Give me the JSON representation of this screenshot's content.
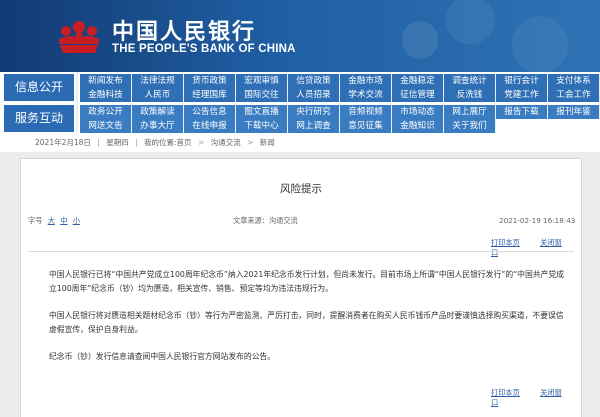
{
  "header": {
    "brand_cn": "中国人民银行",
    "brand_en": "THE PEOPLE'S BANK OF CHINA"
  },
  "nav": {
    "groups": [
      {
        "label": "信息公开",
        "rows": [
          [
            "新闻发布",
            "法律法规",
            "货币政策",
            "宏观审慎",
            "信贷政策",
            "金融市场",
            "金融稳定",
            "调查统计",
            "银行会计",
            "支付体系"
          ],
          [
            "金融科技",
            "人民币",
            "经理国库",
            "国际交往",
            "人员招录",
            "学术交流",
            "征信管理",
            "反洗钱",
            "党建工作",
            "工会工作"
          ]
        ]
      },
      {
        "label": "服务互动",
        "rows": [
          [
            "政务公开",
            "政策解读",
            "公告信息",
            "图文直播",
            "央行研究",
            "音频视频",
            "市场动态",
            "网上展厅",
            "报告下载",
            "报刊年鉴"
          ],
          [
            "网送文告",
            "办事大厅",
            "在线申报",
            "下载中心",
            "网上调查",
            "意见征集",
            "金融知识",
            "关于我们"
          ]
        ]
      }
    ]
  },
  "breadcrumb": {
    "date": "2021年2月18日",
    "weekday": "星期四",
    "location_label": "我的位置:首页",
    "section": "沟通交流",
    "current": "新闻"
  },
  "article": {
    "title": "风险提示",
    "font_label": "字号",
    "font_large": "大",
    "font_medium": "中",
    "font_small": "小",
    "source": "文章来源：沟通交流",
    "datetime": "2021-02-19 16:18:43",
    "print_label": "打印本页",
    "close_label": "关闭窗口",
    "paragraphs": [
      "中国人民银行已将“中国共产党成立100周年纪念币”纳入2021年纪念币发行计划，但尚未发行。目前市场上所谓“中国人民银行发行”的“中国共产党成立100周年”纪念币（钞）均为赝造，相关宣传、销售、预定等均为违法违规行为。",
      "中国人民银行将对赝造相关题材纪念币（钞）等行为严密监测、严厉打击，同时，提醒消费者在购买人民币钱币产品时要谨慎选择购买渠道，不要误信虚假宣传，保护自身利益。",
      "纪念币（钞）发行信息请查阅中国人民银行官方网站发布的公告。"
    ]
  },
  "colors": {
    "header_dark": "#123a73",
    "header_light": "#2f73b4",
    "nav_blue": "#2f6fb6",
    "link_blue": "#2b5ea5",
    "content_bg": "#ececec"
  }
}
